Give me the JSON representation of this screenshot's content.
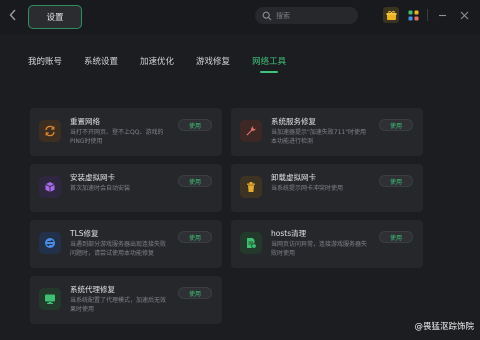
{
  "header": {
    "back_icon": "chevron-left-icon",
    "title": "设置",
    "search_placeholder": "搜索",
    "icons": [
      "gift-icon",
      "grid-apps-icon",
      "minimize-icon",
      "close-icon"
    ]
  },
  "tabs": [
    {
      "label": "我的账号",
      "active": false
    },
    {
      "label": "系统设置",
      "active": false
    },
    {
      "label": "加速优化",
      "active": false
    },
    {
      "label": "游戏修复",
      "active": false
    },
    {
      "label": "网络工具",
      "active": true
    }
  ],
  "tools": [
    {
      "name": "重置网络",
      "desc": "当打不开网页、登不上QQ、游戏的PING时使用",
      "button": "使用",
      "icon": "refresh-icon",
      "color": "#e0862f",
      "bg": "#3c2f22"
    },
    {
      "name": "系统服务修复",
      "desc": "当加速器提示\"加速失败711\"时使用本功能进行检测",
      "button": "使用",
      "icon": "wrench-icon",
      "color": "#e0736a",
      "bg": "#3d2826"
    },
    {
      "name": "安装虚拟网卡",
      "desc": "首次加速时会自动安装",
      "button": "使用",
      "icon": "cube-icon",
      "color": "#a56be8",
      "bg": "#2f2640"
    },
    {
      "name": "卸载虚拟网卡",
      "desc": "当系统提示网卡冲突时使用",
      "button": "使用",
      "icon": "trash-icon",
      "color": "#e4aa32",
      "bg": "#3d3322"
    },
    {
      "name": "TLS修复",
      "desc": "当遇到部分游戏服务器出现连接失败问题时，请尝试使用本功能修复",
      "button": "使用",
      "icon": "tls-icon",
      "color": "#4a8ee8",
      "bg": "#22304a"
    },
    {
      "name": "hosts清理",
      "desc": "当网页访问异常，连接游戏服务器失败时使用",
      "button": "使用",
      "icon": "document-clean-icon",
      "color": "#3fbf72",
      "bg": "#22392c"
    },
    {
      "name": "系统代理修复",
      "desc": "当系统配置了代理模式，加速后无效果时使用",
      "button": "使用",
      "icon": "monitor-icon",
      "color": "#3fbf72",
      "bg": "#22392c"
    }
  ],
  "watermark": "@畏猛沤踪饰院"
}
